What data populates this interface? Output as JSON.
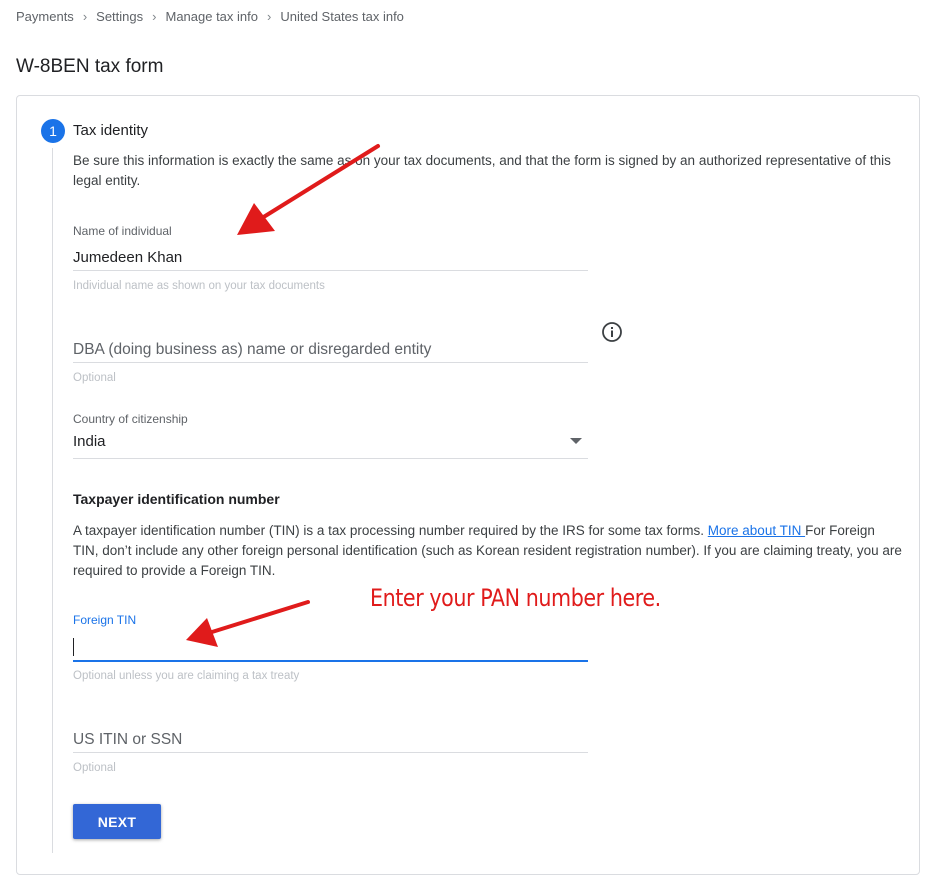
{
  "breadcrumb": [
    "Payments",
    "Settings",
    "Manage tax info",
    "United States tax info"
  ],
  "page_title": "W-8BEN tax form",
  "step": {
    "number": "1",
    "title": "Tax identity",
    "description": "Be sure this information is exactly the same as on your tax documents, and that the form is signed by an authorized representative of this legal entity."
  },
  "name_field": {
    "label": "Name of individual",
    "value": "Jumedeen Khan",
    "hint": "Individual name as shown on your tax documents"
  },
  "dba_field": {
    "placeholder": "DBA (doing business as) name or disregarded entity",
    "hint": "Optional"
  },
  "country_field": {
    "label": "Country of citizenship",
    "value": "India"
  },
  "tin_section": {
    "heading": "Taxpayer identification number",
    "desc_before": "A taxpayer identification number (TIN) is a tax processing number required by the IRS for some tax forms. ",
    "link_text": "More about TIN ",
    "desc_after": "For Foreign TIN, don’t include any other foreign personal identification (such as Korean resident registration number). If you are claiming treaty, you are required to provide a Foreign TIN."
  },
  "foreign_tin": {
    "label": "Foreign TIN",
    "value": "",
    "hint": "Optional unless you are claiming a tax treaty"
  },
  "us_itin": {
    "placeholder": "US ITIN or SSN",
    "hint": "Optional"
  },
  "next_button": "NEXT",
  "annotation": "Enter your PAN number here.",
  "colors": {
    "accent": "#1a73e8",
    "button": "#3367d6",
    "annotation": "#e01b1b"
  },
  "icons": {
    "breadcrumb_separator": "chevron-right-icon",
    "info": "info-icon",
    "dropdown": "dropdown-arrow-icon"
  }
}
